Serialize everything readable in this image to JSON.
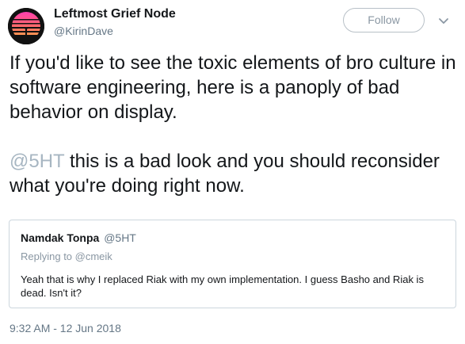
{
  "author": {
    "display_name": "Leftmost Grief Node",
    "handle": "@KirinDave"
  },
  "follow_button": {
    "label": "Follow"
  },
  "tweet": {
    "paragraph1": "If you'd like to see the toxic elements of bro culture in software engineering, here is a panoply of bad behavior on display.",
    "mention": "@5HT",
    "paragraph2_rest": " this is a bad look and you should reconsider what you're doing right now."
  },
  "quoted_tweet": {
    "display_name": "Namdak Tonpa",
    "handle": "@5HT",
    "replying_to": "Replying to @cmeik",
    "text": "Yeah that is why I replaced Riak with my own implementation. I guess Basho and Riak is dead. Isn't it?"
  },
  "timestamp": "9:32 AM - 12 Jun 2018",
  "colors": {
    "mention": "#a7b6c2",
    "secondary_text": "#657786",
    "border": "#ccd6dd"
  },
  "icons": {
    "avatar": "sunset-avatar-icon",
    "caret": "chevron-down-icon"
  }
}
